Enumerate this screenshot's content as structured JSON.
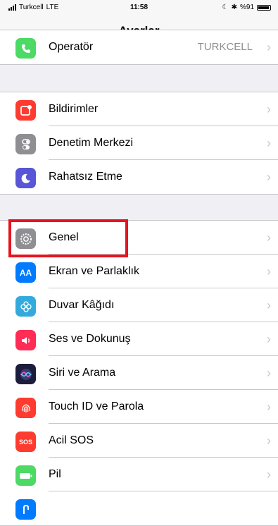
{
  "status_bar": {
    "carrier": "Turkcell",
    "network": "LTE",
    "time": "11:58",
    "battery_text": "%91",
    "battery_level": 0.91
  },
  "nav": {
    "title": "Ayarlar"
  },
  "groups": [
    {
      "rows": [
        {
          "label": "Operatör",
          "value": "TURKCELL",
          "icon": "phone-icon",
          "color": "#4cd964"
        }
      ]
    },
    {
      "rows": [
        {
          "label": "Bildirimler",
          "icon": "notifications-icon",
          "color": "#ff3b30"
        },
        {
          "label": "Denetim Merkezi",
          "icon": "control-center-icon",
          "color": "#8e8e93"
        },
        {
          "label": "Rahatsız Etme",
          "icon": "moon-icon",
          "color": "#5856d6"
        }
      ]
    },
    {
      "rows": [
        {
          "label": "Genel",
          "icon": "gear-icon",
          "color": "#8e8e93"
        },
        {
          "label": "Ekran ve Parlaklık",
          "icon": "display-icon",
          "glyph": "AA",
          "color": "#007aff"
        },
        {
          "label": "Duvar Kâğıdı",
          "icon": "wallpaper-icon",
          "color": "#34aadc"
        },
        {
          "label": "Ses ve Dokunuş",
          "icon": "sound-icon",
          "color": "#ff2d55"
        },
        {
          "label": "Siri ve Arama",
          "icon": "siri-icon",
          "color": "#1c1c3c"
        },
        {
          "label": "Touch ID ve Parola",
          "icon": "fingerprint-icon",
          "color": "#ff3b30"
        },
        {
          "label": "Acil SOS",
          "icon": "sos-icon",
          "glyph": "SOS",
          "color": "#ff3b30"
        },
        {
          "label": "Pil",
          "icon": "battery-icon",
          "color": "#4cd964"
        },
        {
          "label": "",
          "icon": "privacy-icon",
          "color": "#007aff"
        }
      ]
    }
  ]
}
